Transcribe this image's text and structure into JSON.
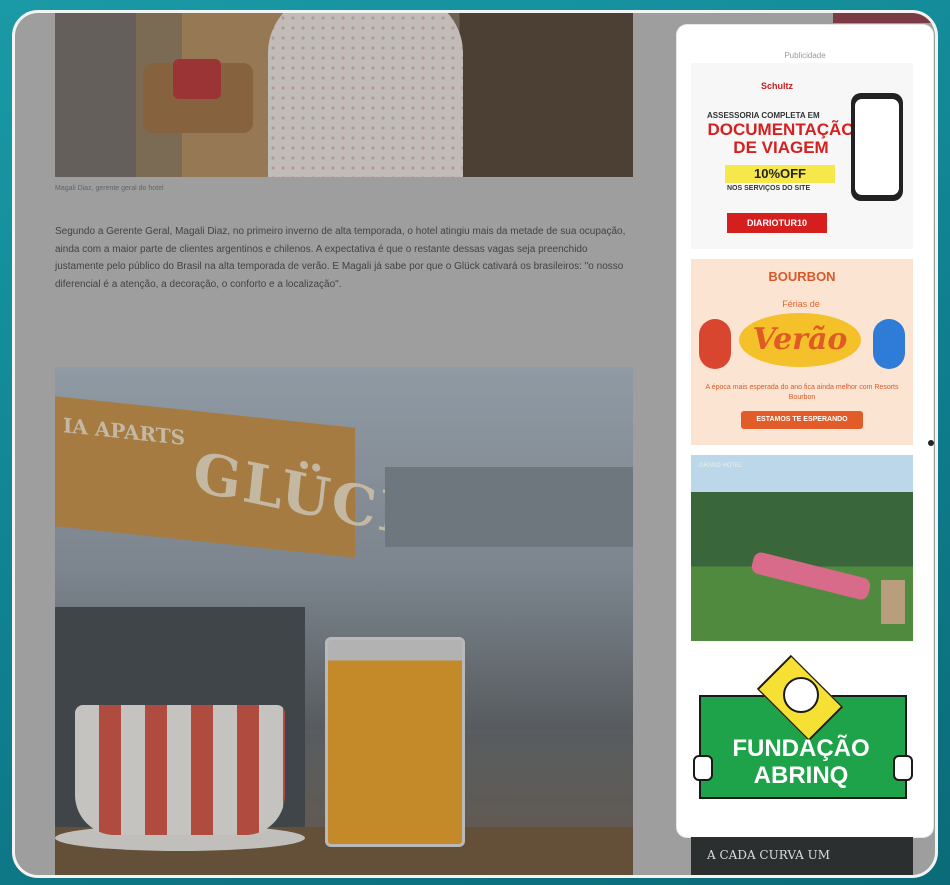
{
  "article": {
    "image1_alt": "Magali Diaz",
    "caption": "Magali Diaz, gerente geral do hotel",
    "paragraph": "Segundo a Gerente Geral, Magali Diaz, no primeiro inverno de alta temporada, o hotel atingiu mais da metade de sua ocupação, ainda com a maior parte de clientes argentinos e chilenos. A expectativa é que o restante dessas vagas seja preenchido justamente pelo público do Brasil na alta temporada de verão. E Magali já sabe por que o Glück cativará os brasileiros: \"o nosso diferencial é a atenção, a decoração, o conforto e a localização\".",
    "sign_small": "IA APARTS",
    "sign_large": "GLÜCK"
  },
  "sidebar": {
    "label": "Publicidade",
    "ad1": {
      "brand": "Schultz",
      "line1": "ASSESSORIA COMPLETA EM",
      "line2": "DOCUMENTAÇÃO DE VIAGEM",
      "discount": "10%OFF",
      "services": "NOS SERVIÇOS DO SITE",
      "code": "DIARIOTUR10"
    },
    "ad2": {
      "brand": "BOURBON",
      "season": "Férias de",
      "headline": "Verão",
      "tagline": "A época mais esperada do ano fica ainda melhor com Resorts Bourbon",
      "button": "ESTAMOS TE ESPERANDO"
    },
    "ad3": {
      "label": "GRAND HOTEL"
    },
    "ad4": {
      "title": "FUNDAÇÃO ABRINQ"
    },
    "ad5": {
      "text": "A CADA CURVA UM"
    }
  }
}
